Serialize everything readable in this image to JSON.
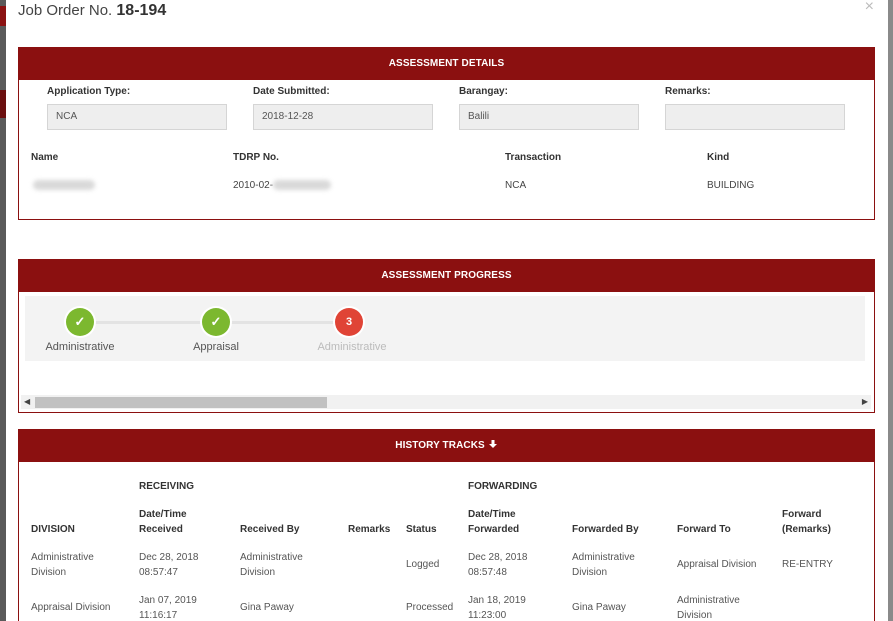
{
  "modal": {
    "title_prefix": "Job Order No.",
    "job_order_no": "18-194",
    "close_symbol": "×"
  },
  "assessment_details": {
    "heading": "ASSESSMENT DETAILS",
    "fields": [
      {
        "label": "Application Type:",
        "value": "NCA"
      },
      {
        "label": "Date Submitted:",
        "value": "2018-12-28"
      },
      {
        "label": "Barangay:",
        "value": "Balili"
      },
      {
        "label": "Remarks:",
        "value": ""
      }
    ],
    "columns": [
      "Name",
      "TDRP No.",
      "Transaction",
      "Kind"
    ],
    "row": {
      "name": "",
      "tdrp_no": "2010-02-",
      "transaction": "NCA",
      "kind": "BUILDING"
    }
  },
  "assessment_progress": {
    "heading": "ASSESSMENT PROGRESS",
    "steps": [
      {
        "label": "Administrative",
        "state": "done",
        "marker": "✓"
      },
      {
        "label": "Appraisal",
        "state": "done",
        "marker": "✓"
      },
      {
        "label": "Administrative",
        "state": "current",
        "marker": "3"
      }
    ],
    "scroll_left": "◀",
    "scroll_right": "▶"
  },
  "history_tracks": {
    "heading": "HISTORY TRACKS",
    "heading_icon": "arrow-down-icon",
    "group_receiving": "RECEIVING",
    "group_forwarding": "FORWARDING",
    "columns": {
      "division": "DIVISION",
      "received_at": "Date/Time Received",
      "received_by": "Received By",
      "remarks": "Remarks",
      "status": "Status",
      "forwarded_at": "Date/Time Forwarded",
      "forwarded_by": "Forwarded By",
      "forward_to": "Forward To",
      "forward_remarks": "Forward (Remarks)"
    },
    "rows": [
      {
        "division": "Administrative Division",
        "received_at": "Dec 28, 2018 08:57:47",
        "received_by": "Administrative Division",
        "remarks": "",
        "status": "Logged",
        "forwarded_at": "Dec 28, 2018 08:57:48",
        "forwarded_by": "Administrative Division",
        "forward_to": "Appraisal Division",
        "forward_remarks": "RE-ENTRY"
      },
      {
        "division": "Appraisal Division",
        "received_at": "Jan 07, 2019 11:16:17",
        "received_by": "Gina Paway",
        "remarks": "",
        "status": "Processed",
        "forwarded_at": "Jan 18, 2019 11:23:00",
        "forwarded_by": "Gina Paway",
        "forward_to": "Administrative Division",
        "forward_remarks": ""
      }
    ]
  },
  "colors": {
    "accent": "#8b1010",
    "done": "#7cb82f",
    "current": "#e04436"
  }
}
